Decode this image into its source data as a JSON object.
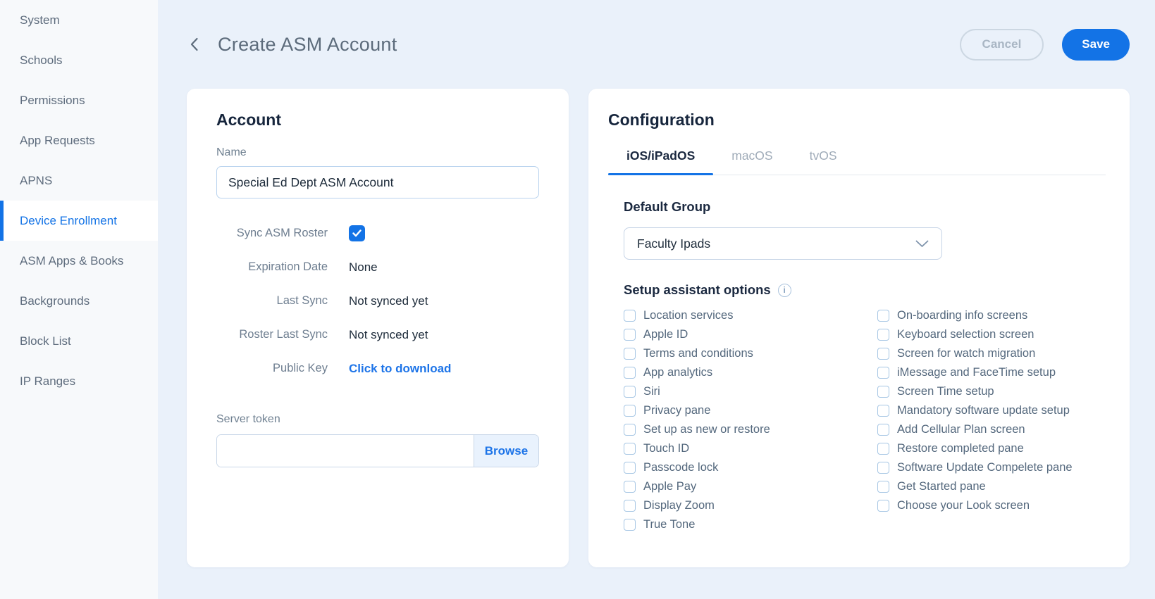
{
  "colors": {
    "accent_blue": "#1373e6",
    "link_blue": "#1d74e8",
    "page_background": "#eaf1fa",
    "sidebar_background": "#f7f9fb",
    "card_background": "#ffffff",
    "heading_text": "#16253c",
    "muted_text": "#6e7e90"
  },
  "icons": {
    "back": "chevron-left",
    "dropdown": "chevron-down",
    "info": "info-circle",
    "checked": "checkmark"
  },
  "sidebar": {
    "items": [
      {
        "label": "System",
        "active": false
      },
      {
        "label": "Schools",
        "active": false
      },
      {
        "label": "Permissions",
        "active": false
      },
      {
        "label": "App Requests",
        "active": false
      },
      {
        "label": "APNS",
        "active": false
      },
      {
        "label": "Device Enrollment",
        "active": true
      },
      {
        "label": "ASM Apps & Books",
        "active": false
      },
      {
        "label": "Backgrounds",
        "active": false
      },
      {
        "label": "Block List",
        "active": false
      },
      {
        "label": "IP Ranges",
        "active": false
      }
    ]
  },
  "header": {
    "title": "Create ASM Account",
    "cancel_label": "Cancel",
    "save_label": "Save"
  },
  "account_card": {
    "title": "Account",
    "name_label": "Name",
    "name_value": "Special Ed Dept ASM Account",
    "rows": [
      {
        "label": "Sync ASM Roster",
        "type": "checkbox",
        "checked": true
      },
      {
        "label": "Expiration Date",
        "value": "None"
      },
      {
        "label": "Last Sync",
        "value": "Not synced yet"
      },
      {
        "label": "Roster Last Sync",
        "value": "Not synced yet"
      },
      {
        "label": "Public Key",
        "value": "Click to download",
        "link": true
      }
    ],
    "server_token_label": "Server token",
    "server_token_value": "",
    "browse_label": "Browse"
  },
  "config_card": {
    "title": "Configuration",
    "tabs": [
      {
        "label": "iOS/iPadOS",
        "active": true
      },
      {
        "label": "macOS",
        "active": false
      },
      {
        "label": "tvOS",
        "active": false
      }
    ],
    "default_group_label": "Default Group",
    "default_group_value": "Faculty Ipads",
    "setup_options_label": "Setup assistant options",
    "options_col1": [
      "Location services",
      "Apple ID",
      "Terms and conditions",
      "App analytics",
      "Siri",
      "Privacy pane",
      "Set up as new or restore",
      "Touch ID",
      "Passcode lock",
      "Apple Pay",
      "Display Zoom",
      "True Tone"
    ],
    "options_col2": [
      "On-boarding info screens",
      "Keyboard selection screen",
      "Screen for watch migration",
      "iMessage and FaceTime setup",
      "Screen Time setup",
      "Mandatory software update setup",
      "Add Cellular Plan screen",
      "Restore completed pane",
      "Software Update Compelete pane",
      "Get Started pane",
      "Choose your Look screen"
    ]
  }
}
